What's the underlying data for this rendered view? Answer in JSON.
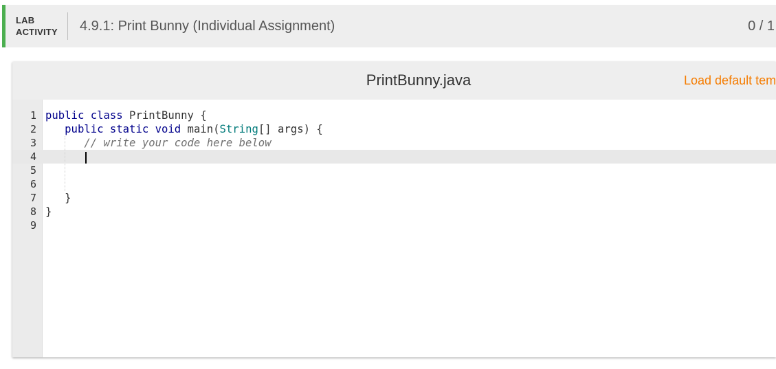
{
  "header": {
    "lab_line1": "LAB",
    "lab_line2": "ACTIVITY",
    "title": "4.9.1: Print Bunny (Individual Assignment)",
    "score": "0 / 1",
    "accent_color": "#4caf50"
  },
  "editor": {
    "filename": "PrintBunny.java",
    "load_default_label": "Load default template...",
    "active_line": 4,
    "lines": [
      {
        "num": "1",
        "text": "public class PrintBunny {"
      },
      {
        "num": "2",
        "text": "   public static void main(String[] args) {"
      },
      {
        "num": "3",
        "text": "      // write your code here below"
      },
      {
        "num": "4",
        "text": ""
      },
      {
        "num": "5",
        "text": ""
      },
      {
        "num": "6",
        "text": ""
      },
      {
        "num": "7",
        "text": "   }"
      },
      {
        "num": "8",
        "text": "}"
      },
      {
        "num": "9",
        "text": ""
      }
    ],
    "load_default_color": "#f57c00"
  }
}
